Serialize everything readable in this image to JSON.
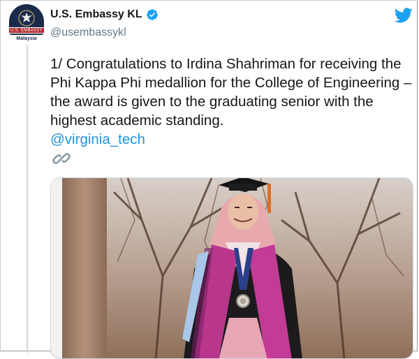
{
  "account": {
    "name": "U.S. Embassy KL",
    "handle": "@usembassykl",
    "verified": true,
    "avatar_ribbon": "U.S. EMBASSY",
    "avatar_country": "Malaysia"
  },
  "tweet": {
    "text": "1/ Congratulations to Irdina Shahriman for receiving the Phi Kappa Phi medallion for the College of Engineering – the award is given to the graduating senior with the highest academic standing.",
    "mention": "@virginia_tech"
  },
  "icons": {
    "brand": "twitter-bird-icon",
    "link": "link-icon",
    "verified": "verified-badge-icon"
  },
  "colors": {
    "accent": "#1da1f2",
    "mention": "#1b95e0",
    "text": "#14171a",
    "secondary": "#657786"
  },
  "media": {
    "alt": "Graduate in black gown, pink hijab and purple stole wearing a medallion"
  }
}
